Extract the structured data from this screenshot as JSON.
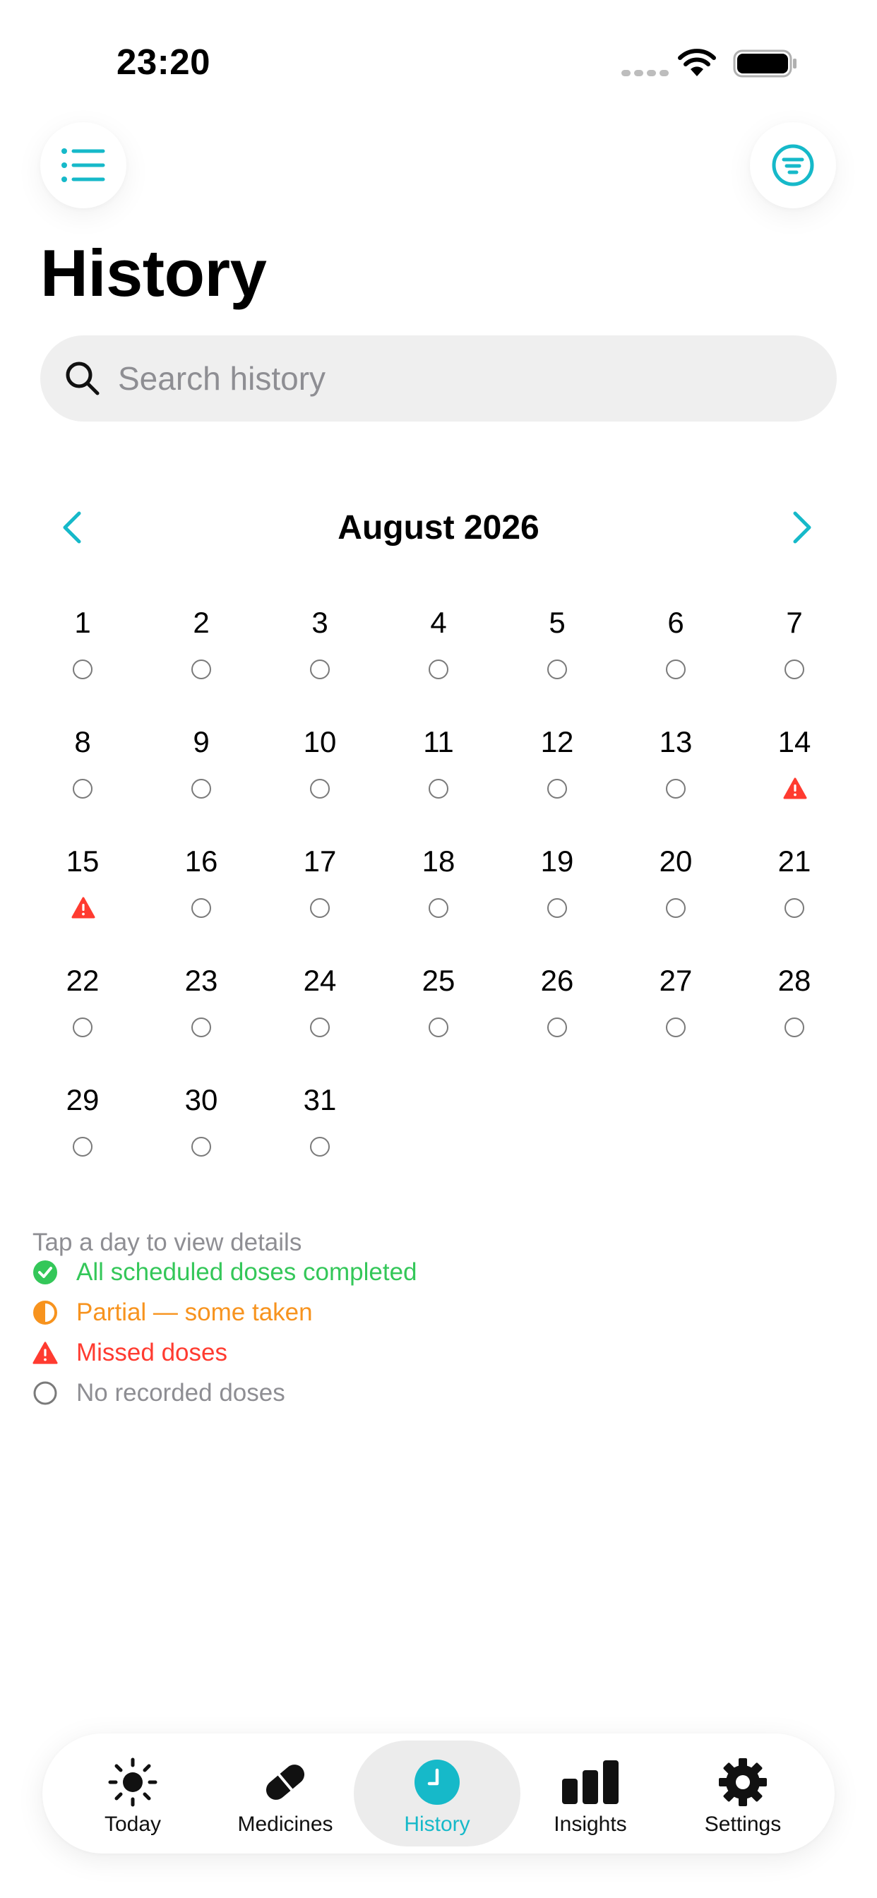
{
  "status_bar": {
    "time": "23:20"
  },
  "header": {
    "title": "History"
  },
  "search": {
    "placeholder": "Search history",
    "value": ""
  },
  "calendar": {
    "month_label": "August 2026",
    "days": [
      {
        "day": "1",
        "status": "none"
      },
      {
        "day": "2",
        "status": "none"
      },
      {
        "day": "3",
        "status": "none"
      },
      {
        "day": "4",
        "status": "none"
      },
      {
        "day": "5",
        "status": "none"
      },
      {
        "day": "6",
        "status": "none"
      },
      {
        "day": "7",
        "status": "none"
      },
      {
        "day": "8",
        "status": "none"
      },
      {
        "day": "9",
        "status": "none"
      },
      {
        "day": "10",
        "status": "none"
      },
      {
        "day": "11",
        "status": "none"
      },
      {
        "day": "12",
        "status": "none"
      },
      {
        "day": "13",
        "status": "none"
      },
      {
        "day": "14",
        "status": "missed"
      },
      {
        "day": "15",
        "status": "missed"
      },
      {
        "day": "16",
        "status": "none"
      },
      {
        "day": "17",
        "status": "none"
      },
      {
        "day": "18",
        "status": "none"
      },
      {
        "day": "19",
        "status": "none"
      },
      {
        "day": "20",
        "status": "none"
      },
      {
        "day": "21",
        "status": "none"
      },
      {
        "day": "22",
        "status": "none"
      },
      {
        "day": "23",
        "status": "none"
      },
      {
        "day": "24",
        "status": "none"
      },
      {
        "day": "25",
        "status": "none"
      },
      {
        "day": "26",
        "status": "none"
      },
      {
        "day": "27",
        "status": "none"
      },
      {
        "day": "28",
        "status": "none"
      },
      {
        "day": "29",
        "status": "none"
      },
      {
        "day": "30",
        "status": "none"
      },
      {
        "day": "31",
        "status": "none"
      }
    ]
  },
  "legend": {
    "hint": "Tap a day to view details",
    "items": [
      {
        "label": "All scheduled doses completed",
        "status": "completed",
        "color": "#34c759"
      },
      {
        "label": "Partial — some taken",
        "status": "partial",
        "color": "#f7931e"
      },
      {
        "label": "Missed doses",
        "status": "missed",
        "color": "#ff3b30"
      },
      {
        "label": "No recorded doses",
        "status": "none",
        "color": "#8e8e93"
      }
    ]
  },
  "tabs": [
    {
      "label": "Today",
      "icon": "sun-icon",
      "active": false
    },
    {
      "label": "Medicines",
      "icon": "pill-icon",
      "active": false
    },
    {
      "label": "History",
      "icon": "clock-icon",
      "active": true
    },
    {
      "label": "Insights",
      "icon": "bar-chart-icon",
      "active": false
    },
    {
      "label": "Settings",
      "icon": "gear-icon",
      "active": false
    }
  ],
  "colors": {
    "accent": "#16b9c9",
    "missed": "#ff3b30",
    "completed": "#34c759",
    "partial": "#f7931e",
    "muted": "#8e8e93"
  }
}
